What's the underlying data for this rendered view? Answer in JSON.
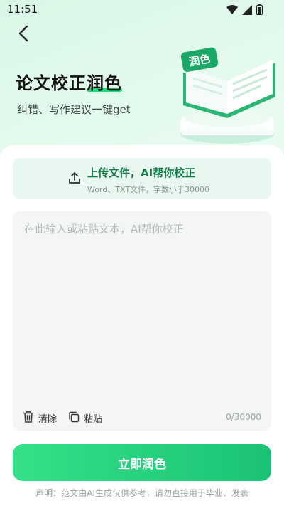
{
  "status_bar": {
    "time": "11:51",
    "icons": [
      "wifi-icon",
      "signal-icon",
      "battery-icon"
    ]
  },
  "header": {
    "title_part1": "论文校正",
    "title_part2": "润色",
    "subtitle": "纠错、写作建议一键get",
    "badge": "润色"
  },
  "upload": {
    "title": "上传文件，AI帮你校正",
    "hint": "Word、TXT文件，字数小于30000"
  },
  "editor": {
    "placeholder": "在此输入或粘贴文本，AI帮你校正",
    "value": "",
    "clear_label": "清除",
    "paste_label": "粘贴",
    "counter": "0/30000"
  },
  "submit_label": "立即润色",
  "disclaimer": "声明：范文由AI生成仅供参考，请勿直接用于毕业、发表",
  "colors": {
    "accent": "#1bc276",
    "accent_dark": "#137a47",
    "upload_bg": "#e8f7ef",
    "editor_bg": "#f4f6f5"
  }
}
